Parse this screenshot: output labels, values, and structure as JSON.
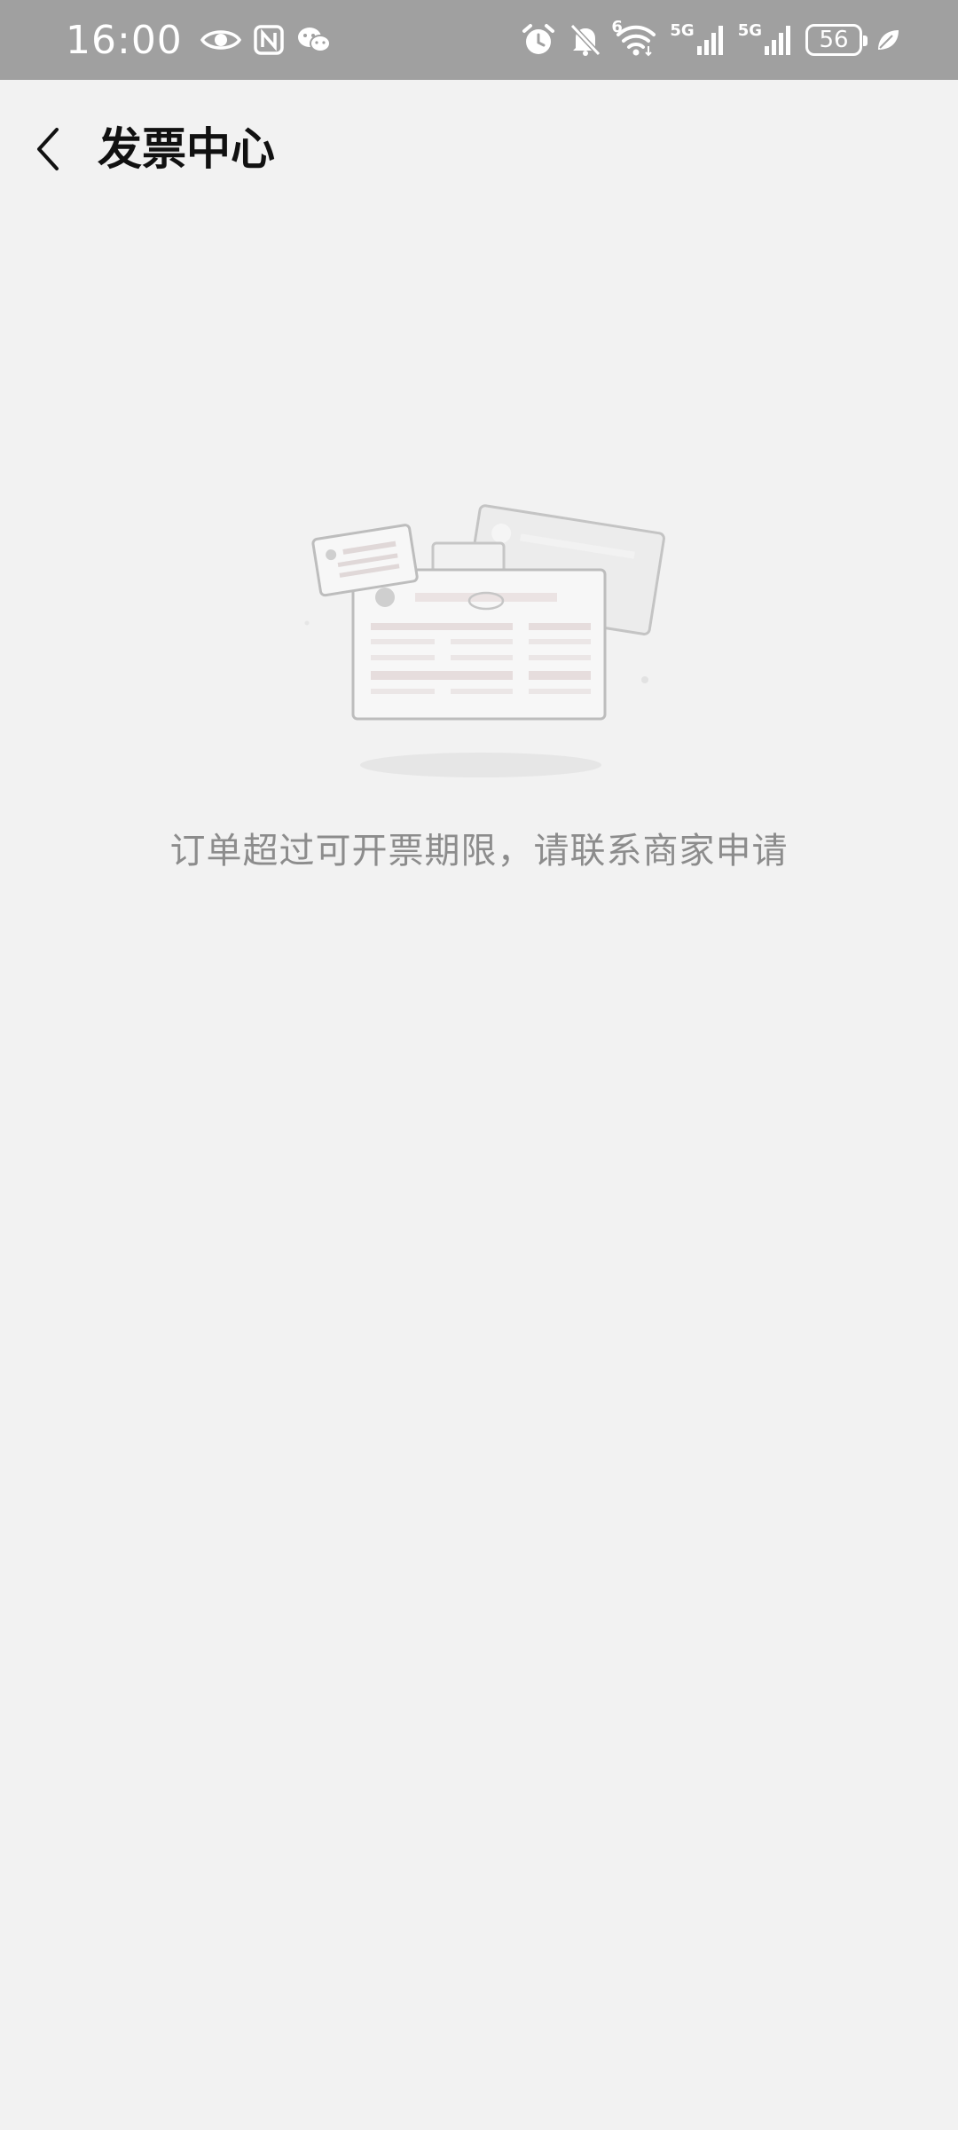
{
  "status_bar": {
    "time": "16:00",
    "left_icons": [
      "eye-icon",
      "nfc-icon",
      "wechat-icon"
    ],
    "right_icons": [
      "alarm-icon",
      "bell-muted-icon",
      "wifi-icon",
      "signal-5g-icon",
      "signal-5g-icon",
      "battery-icon",
      "leaf-icon"
    ],
    "wifi_badge": "6",
    "signal_1_label": "5G",
    "signal_2_label": "5G",
    "battery_level": "56"
  },
  "header": {
    "title": "发票中心",
    "back_icon": "chevron-left-icon"
  },
  "empty_state": {
    "illustration": "invoice-documents-illustration",
    "message": "订单超过可开票期限，请联系商家申请"
  },
  "colors": {
    "status_bar_bg": "#a0a0a0",
    "page_bg": "#f2f2f2",
    "title_text": "#111111",
    "message_text": "#8c8c8c"
  }
}
